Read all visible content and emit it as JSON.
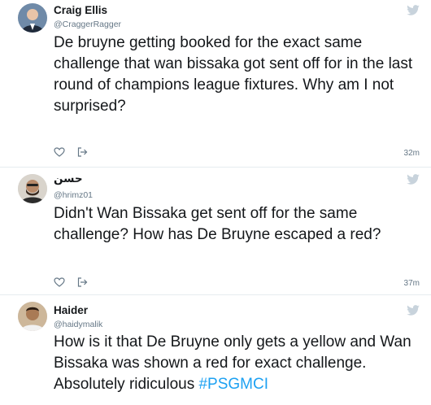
{
  "tweets": [
    {
      "name": "Craig Ellis",
      "handle": "@CraggerRagger",
      "text": "De bruyne getting booked for the exact same challenge that wan bissaka got sent off for in the last round of champions league fixtures. Why am I not surprised?",
      "time": "32m"
    },
    {
      "name": "حسن",
      "handle": "@hrimz01",
      "text": "Didn't Wan Bissaka get sent off for the same challenge? How has De Bruyne escaped a red?",
      "time": "37m"
    },
    {
      "name": "Haider",
      "handle": "@haidymalik",
      "text_before": "How is it that De Bruyne only gets a yellow and Wan Bissaka was shown a red for exact challenge. Absolutely ridiculous ",
      "hashtag": "#PSGMCI"
    }
  ],
  "icons": {
    "brand": "twitter-bird-icon",
    "like": "heart-icon",
    "share": "share-icon"
  },
  "colors": {
    "bird": "#c8d3dc",
    "hashtag": "#1da1f2",
    "meta": "#657786"
  }
}
